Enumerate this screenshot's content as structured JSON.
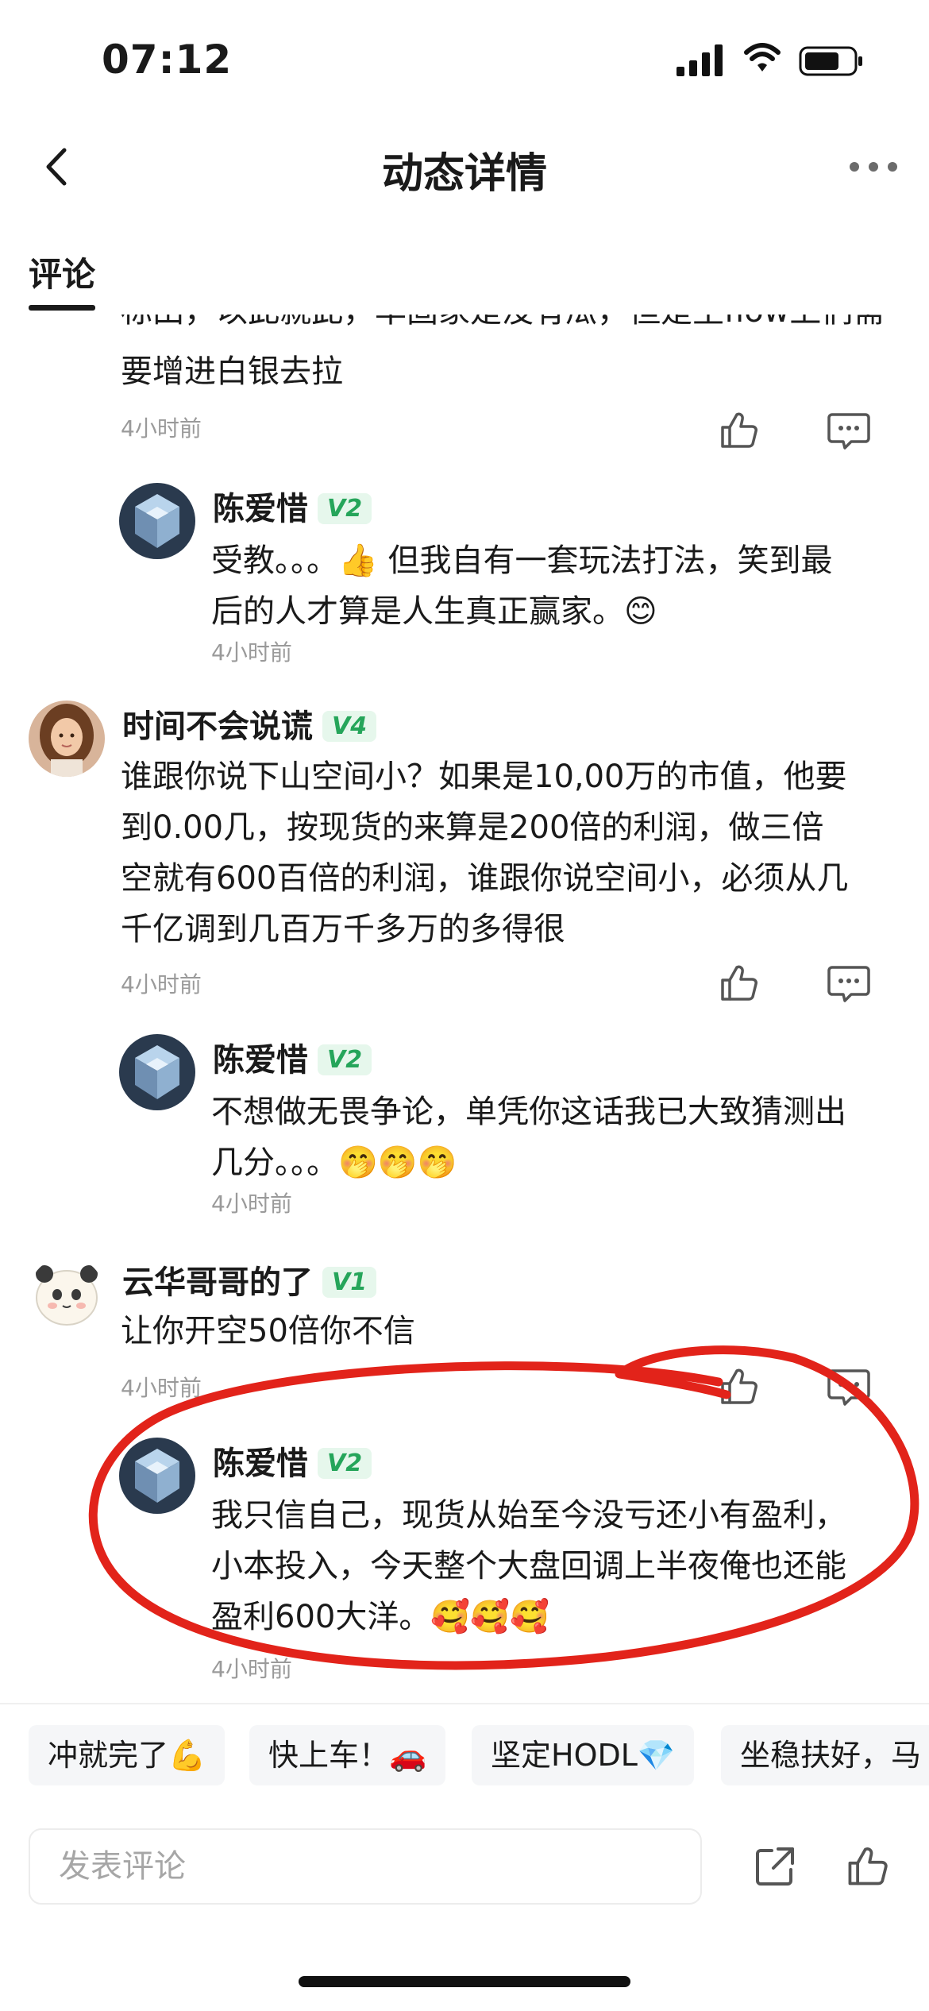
{
  "status_bar": {
    "time": "07:12"
  },
  "nav": {
    "title": "动态详情"
  },
  "tabs": [
    {
      "label": "评论",
      "active": true
    }
  ],
  "comments": [
    {
      "id": "c0",
      "text_partial_top": "标田，以此就此，率固家是没有瓜，但是主flow上们需",
      "text_lines": [
        "要增进白银去拉"
      ],
      "time": "4小时前",
      "reply": {
        "author": "陈爱惜",
        "level": "V2",
        "text_lines": [
          "受教。。。👍 但我自有一套玩法打法，笑到最",
          "后的人才算是人生真正赢家。😊"
        ],
        "time": "4小时前"
      }
    },
    {
      "id": "c1",
      "author": "时间不会说谎",
      "level": "V4",
      "text_lines": [
        "谁跟你说下山空间小？如果是10,00万的市值，他要",
        "到0.00几，按现货的来算是200倍的利润，做三倍",
        "空就有600百倍的利润，谁跟你说空间小，必须从几",
        "千亿调到几百万千多万的多得很"
      ],
      "time": "4小时前",
      "reply": {
        "author": "陈爱惜",
        "level": "V2",
        "text_lines": [
          "不想做无畏争论，单凭你这话我已大致猜测出",
          "几分。。。🤭🤭🤭"
        ],
        "time": "4小时前"
      }
    },
    {
      "id": "c2",
      "author": "云华哥哥的了",
      "level": "V1",
      "text_lines": [
        "让你开空50倍你不信"
      ],
      "time": "4小时前",
      "reply": {
        "author": "陈爱惜",
        "level": "V2",
        "text_lines": [
          "我只信自己，现货从始至今没亏还小有盈利，",
          "小本投入，今天整个大盘回调上半夜俺也还能",
          "盈利600大洋。🥰🥰🥰"
        ],
        "time": "4小时前"
      }
    }
  ],
  "quick_replies": [
    "冲就完了💪",
    "快上车！🚗",
    "坚定HODL💎",
    "坐稳扶好，马"
  ],
  "bottom_bar": {
    "input_placeholder": "发表评论"
  },
  "annotation": {
    "color": "#e2231a"
  },
  "colors": {
    "badge_bg": "#e6f7ec",
    "badge_text": "#25a55a",
    "time_text": "#9a9a9a"
  }
}
